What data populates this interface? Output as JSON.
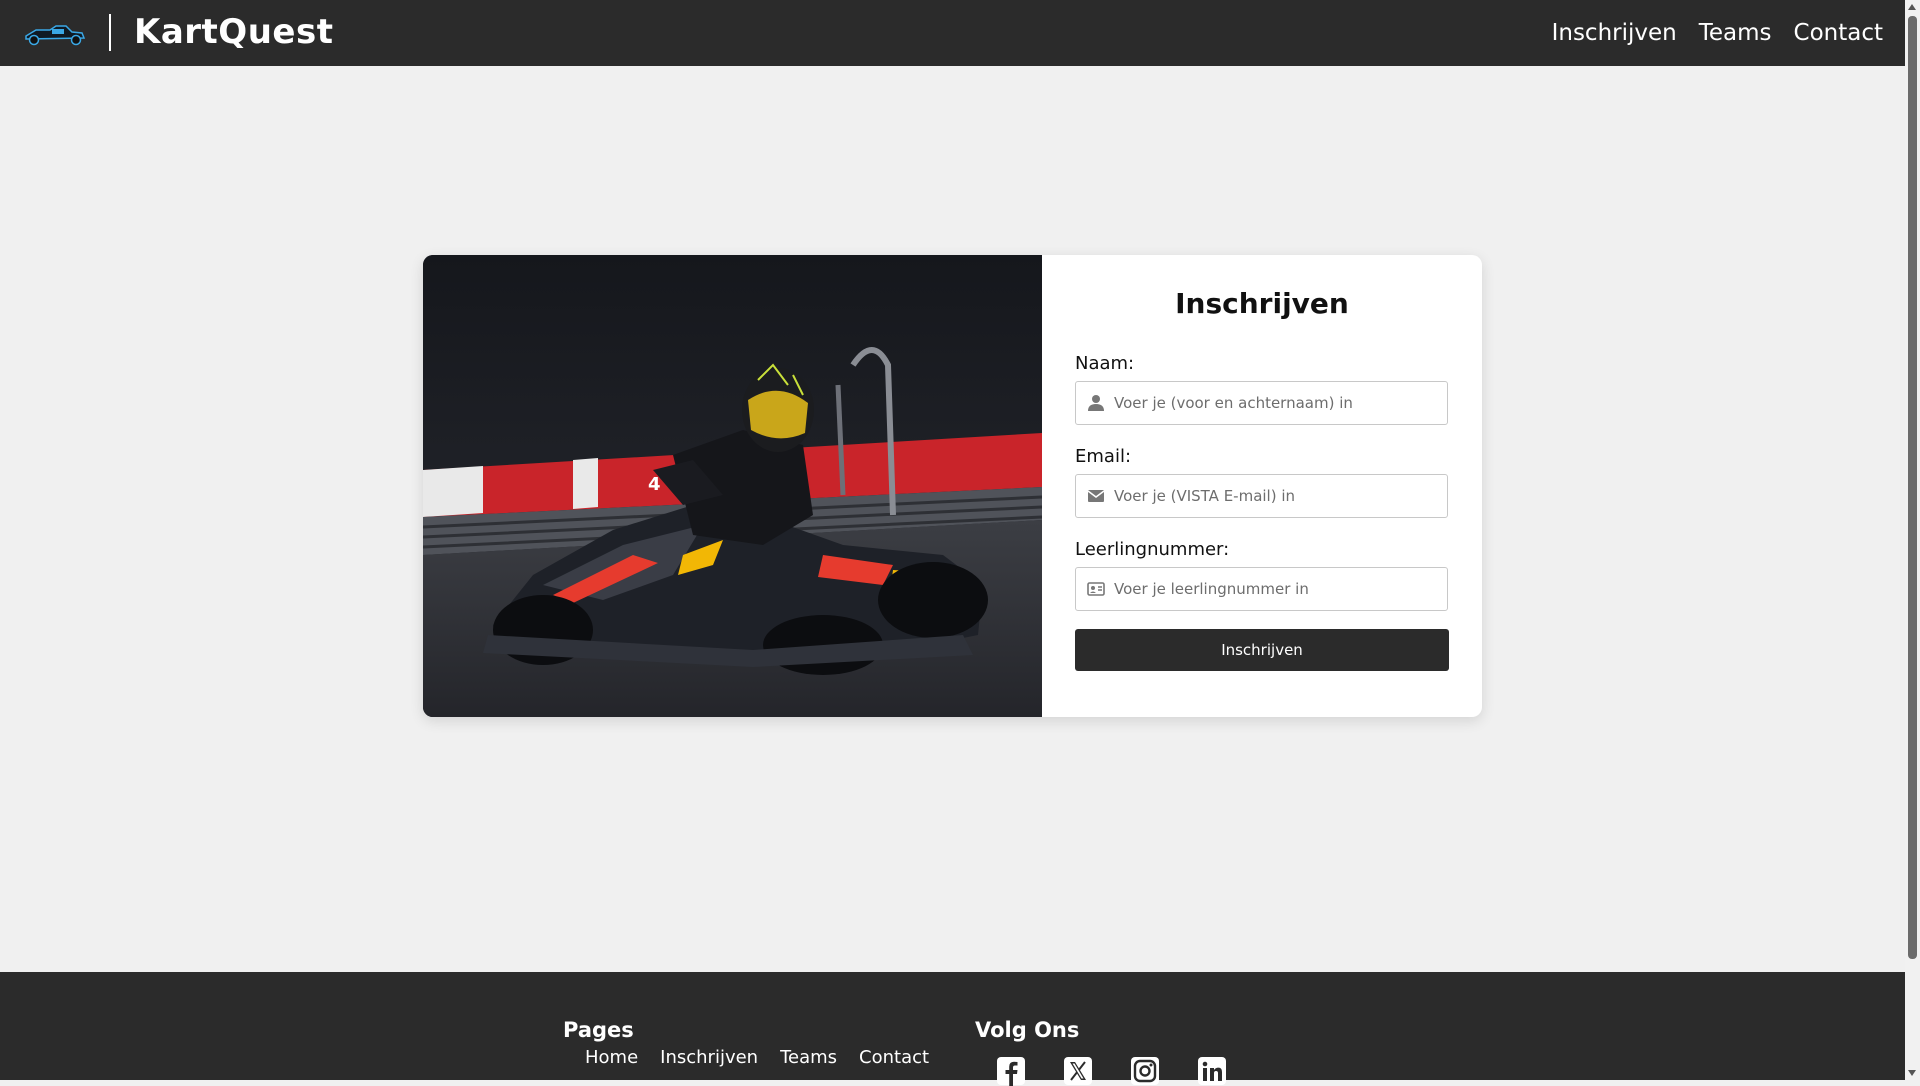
{
  "header": {
    "brand": "KartQuest",
    "logo_icon": "go-kart-icon",
    "nav": [
      "Inschrijven",
      "Teams",
      "Contact"
    ]
  },
  "form": {
    "title": "Inschrijven",
    "name_label": "Naam:",
    "name_placeholder": "Voer je (voor en achternaam) in",
    "name_icon": "user-icon",
    "email_label": "Email:",
    "email_placeholder": "Voer je (VISTA E-mail) in",
    "email_icon": "envelope-icon",
    "student_label": "Leerlingnummer:",
    "student_placeholder": "Voer je leerlingnummer in",
    "student_icon": "id-card-icon",
    "submit": "Inschrijven"
  },
  "footer": {
    "pages_heading": "Pages",
    "pages": [
      "Home",
      "Inschrijven",
      "Teams",
      "Contact"
    ],
    "follow_heading": "Volg Ons",
    "social_icons": [
      "facebook-icon",
      "x-icon",
      "instagram-icon",
      "linkedin-icon"
    ]
  },
  "colors": {
    "nav_bg": "#2b2b2b",
    "page_bg": "#f0f0f0",
    "button_bg": "#2b2b2b",
    "kart_accent": "#e63b2e"
  }
}
